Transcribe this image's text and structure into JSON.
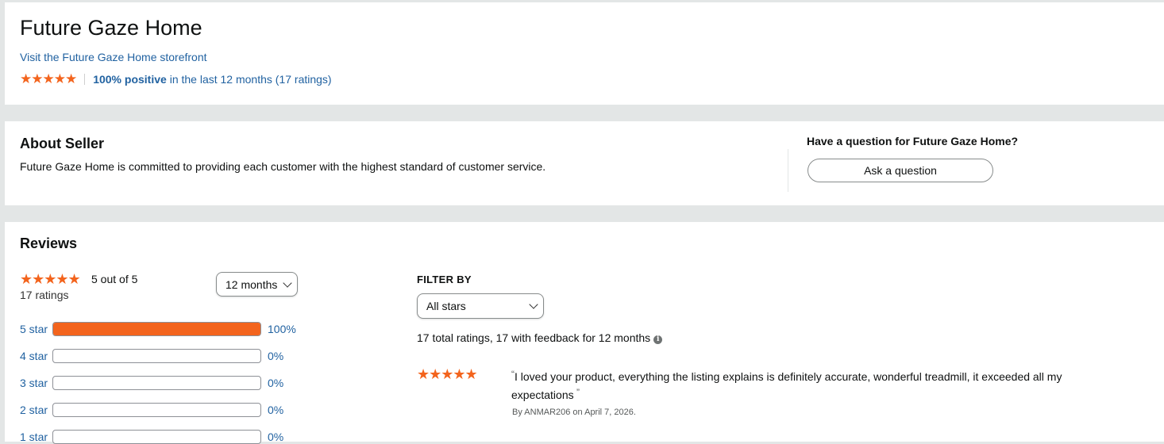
{
  "header": {
    "seller_name": "Future Gaze Home",
    "storefront_link": "Visit the Future Gaze Home storefront",
    "stars": "★★★★★",
    "positive": "100% positive",
    "positive_suffix": " in the last 12 months (17 ratings)"
  },
  "about": {
    "title": "About Seller",
    "description": "Future Gaze Home is committed to providing each customer with the highest standard of customer service.",
    "question_title": "Have a question for Future Gaze Home?",
    "ask_button": "Ask a question"
  },
  "reviews": {
    "title": "Reviews",
    "stars": "★★★★★",
    "rating_text": "5 out of  5",
    "ratings_count": "17 ratings",
    "period_select": "12 months",
    "breakdown": [
      {
        "label": "5 star",
        "percent_text": "100%",
        "fraction": 1.0
      },
      {
        "label": "4 star",
        "percent_text": "0%",
        "fraction": 0
      },
      {
        "label": "3 star",
        "percent_text": "0%",
        "fraction": 0
      },
      {
        "label": "2 star",
        "percent_text": "0%",
        "fraction": 0
      },
      {
        "label": "1 star",
        "percent_text": "0%",
        "fraction": 0
      }
    ],
    "filter": {
      "title": "FILTER BY",
      "selected": "All stars",
      "summary": "17 total ratings, 17 with feedback for 12 months",
      "info_icon": "i"
    },
    "review": {
      "stars": "★★★★★",
      "text": "I loved your product, everything the listing explains is definitely accurate, wonderful treadmill, it exceeded all my expectations",
      "byline": "By ANMAR206 on April 7, 2026."
    }
  },
  "colors": {
    "star": "#f3641d",
    "link": "#2162a1",
    "background": "#e3e6e6"
  }
}
